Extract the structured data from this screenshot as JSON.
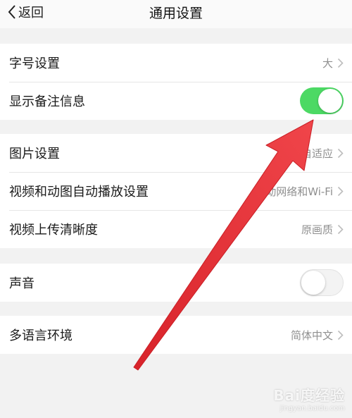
{
  "navbar": {
    "back_label": "返回",
    "title": "通用设置"
  },
  "groups": [
    {
      "rows": [
        {
          "label": "字号设置",
          "value": "大"
        },
        {
          "label": "显示备注信息",
          "toggle": "on"
        }
      ]
    },
    {
      "rows": [
        {
          "label": "图片设置",
          "value": "自适应"
        },
        {
          "label": "视频和动图自动播放设置",
          "value": "移动网络和Wi-Fi"
        },
        {
          "label": "视频上传清晰度",
          "value": "原画质"
        }
      ]
    },
    {
      "rows": [
        {
          "label": "声音",
          "toggle": "off"
        }
      ]
    },
    {
      "rows": [
        {
          "label": "多语言环境",
          "value": "简体中文"
        }
      ]
    }
  ],
  "colors": {
    "toggle_on": "#4cd964",
    "annotation_arrow": "#e8383d",
    "background": "#f2f2f2"
  },
  "watermark": {
    "main": "Bai度经验",
    "sub": "jingyan.baidu.com"
  }
}
